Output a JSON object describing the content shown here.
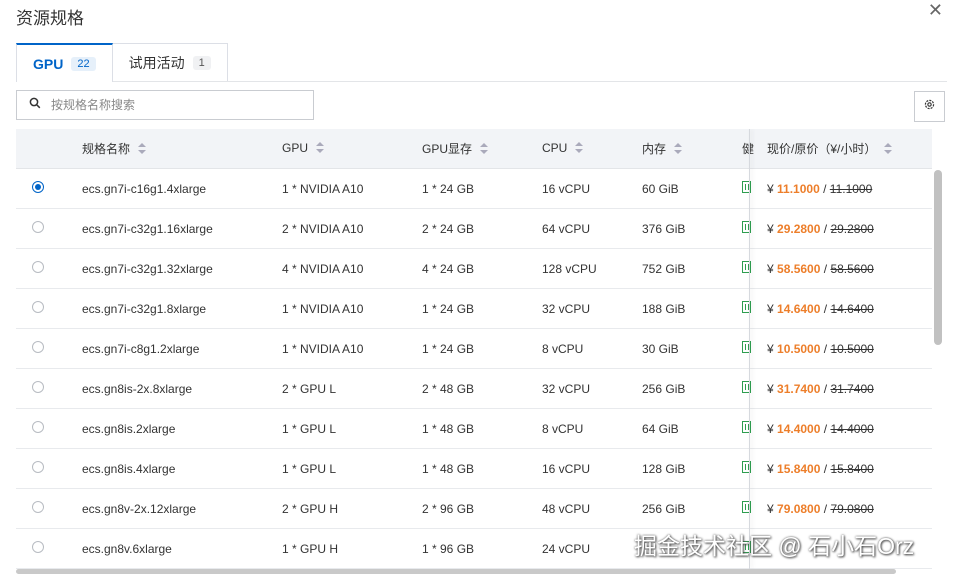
{
  "dialog": {
    "title": "资源规格",
    "close": "✕"
  },
  "tabs": [
    {
      "label": "GPU",
      "count": "22"
    },
    {
      "label": "试用活动",
      "count": "1"
    }
  ],
  "search": {
    "placeholder": "按规格名称搜索"
  },
  "columns": [
    "规格名称",
    "GPU",
    "GPU显存",
    "CPU",
    "内存",
    "健",
    "现价/原价（¥/小时）"
  ],
  "rows": [
    {
      "name": "ecs.gn7i-c16g1.4xlarge",
      "gpu": "1 * NVIDIA A10",
      "mem_gpu": "1 * 24 GB",
      "cpu": "16 vCPU",
      "mem": "60 GiB",
      "cur": "¥",
      "price": "11.1000",
      "sep": "/",
      "orig": "11.1000"
    },
    {
      "name": "ecs.gn7i-c32g1.16xlarge",
      "gpu": "2 * NVIDIA A10",
      "mem_gpu": "2 * 24 GB",
      "cpu": "64 vCPU",
      "mem": "376 GiB",
      "cur": "¥",
      "price": "29.2800",
      "sep": "/",
      "orig": "29.2800"
    },
    {
      "name": "ecs.gn7i-c32g1.32xlarge",
      "gpu": "4 * NVIDIA A10",
      "mem_gpu": "4 * 24 GB",
      "cpu": "128 vCPU",
      "mem": "752 GiB",
      "cur": "¥",
      "price": "58.5600",
      "sep": "/",
      "orig": "58.5600"
    },
    {
      "name": "ecs.gn7i-c32g1.8xlarge",
      "gpu": "1 * NVIDIA A10",
      "mem_gpu": "1 * 24 GB",
      "cpu": "32 vCPU",
      "mem": "188 GiB",
      "cur": "¥",
      "price": "14.6400",
      "sep": "/",
      "orig": "14.6400"
    },
    {
      "name": "ecs.gn7i-c8g1.2xlarge",
      "gpu": "1 * NVIDIA A10",
      "mem_gpu": "1 * 24 GB",
      "cpu": "8 vCPU",
      "mem": "30 GiB",
      "cur": "¥",
      "price": "10.5000",
      "sep": "/",
      "orig": "10.5000"
    },
    {
      "name": "ecs.gn8is-2x.8xlarge",
      "gpu": "2 * GPU L",
      "mem_gpu": "2 * 48 GB",
      "cpu": "32 vCPU",
      "mem": "256 GiB",
      "cur": "¥",
      "price": "31.7400",
      "sep": "/",
      "orig": "31.7400"
    },
    {
      "name": "ecs.gn8is.2xlarge",
      "gpu": "1 * GPU L",
      "mem_gpu": "1 * 48 GB",
      "cpu": "8 vCPU",
      "mem": "64 GiB",
      "cur": "¥",
      "price": "14.4000",
      "sep": "/",
      "orig": "14.4000"
    },
    {
      "name": "ecs.gn8is.4xlarge",
      "gpu": "1 * GPU L",
      "mem_gpu": "1 * 48 GB",
      "cpu": "16 vCPU",
      "mem": "128 GiB",
      "cur": "¥",
      "price": "15.8400",
      "sep": "/",
      "orig": "15.8400"
    },
    {
      "name": "ecs.gn8v-2x.12xlarge",
      "gpu": "2 * GPU H",
      "mem_gpu": "2 * 96 GB",
      "cpu": "48 vCPU",
      "mem": "256 GiB",
      "cur": "¥",
      "price": "79.0800",
      "sep": "/",
      "orig": "79.0800"
    },
    {
      "name": "ecs.gn8v.6xlarge",
      "gpu": "1 * GPU H",
      "mem_gpu": "1 * 96 GB",
      "cpu": "24 vCPU",
      "mem": "",
      "cur": "",
      "price": "",
      "sep": "",
      "orig": ""
    }
  ],
  "selected_index": 0,
  "watermark": "掘金技术社区 @ 石小石Orz",
  "colors": {
    "accent": "#0064c8",
    "price": "#ed7e2a",
    "health": "#2e9e4f"
  }
}
